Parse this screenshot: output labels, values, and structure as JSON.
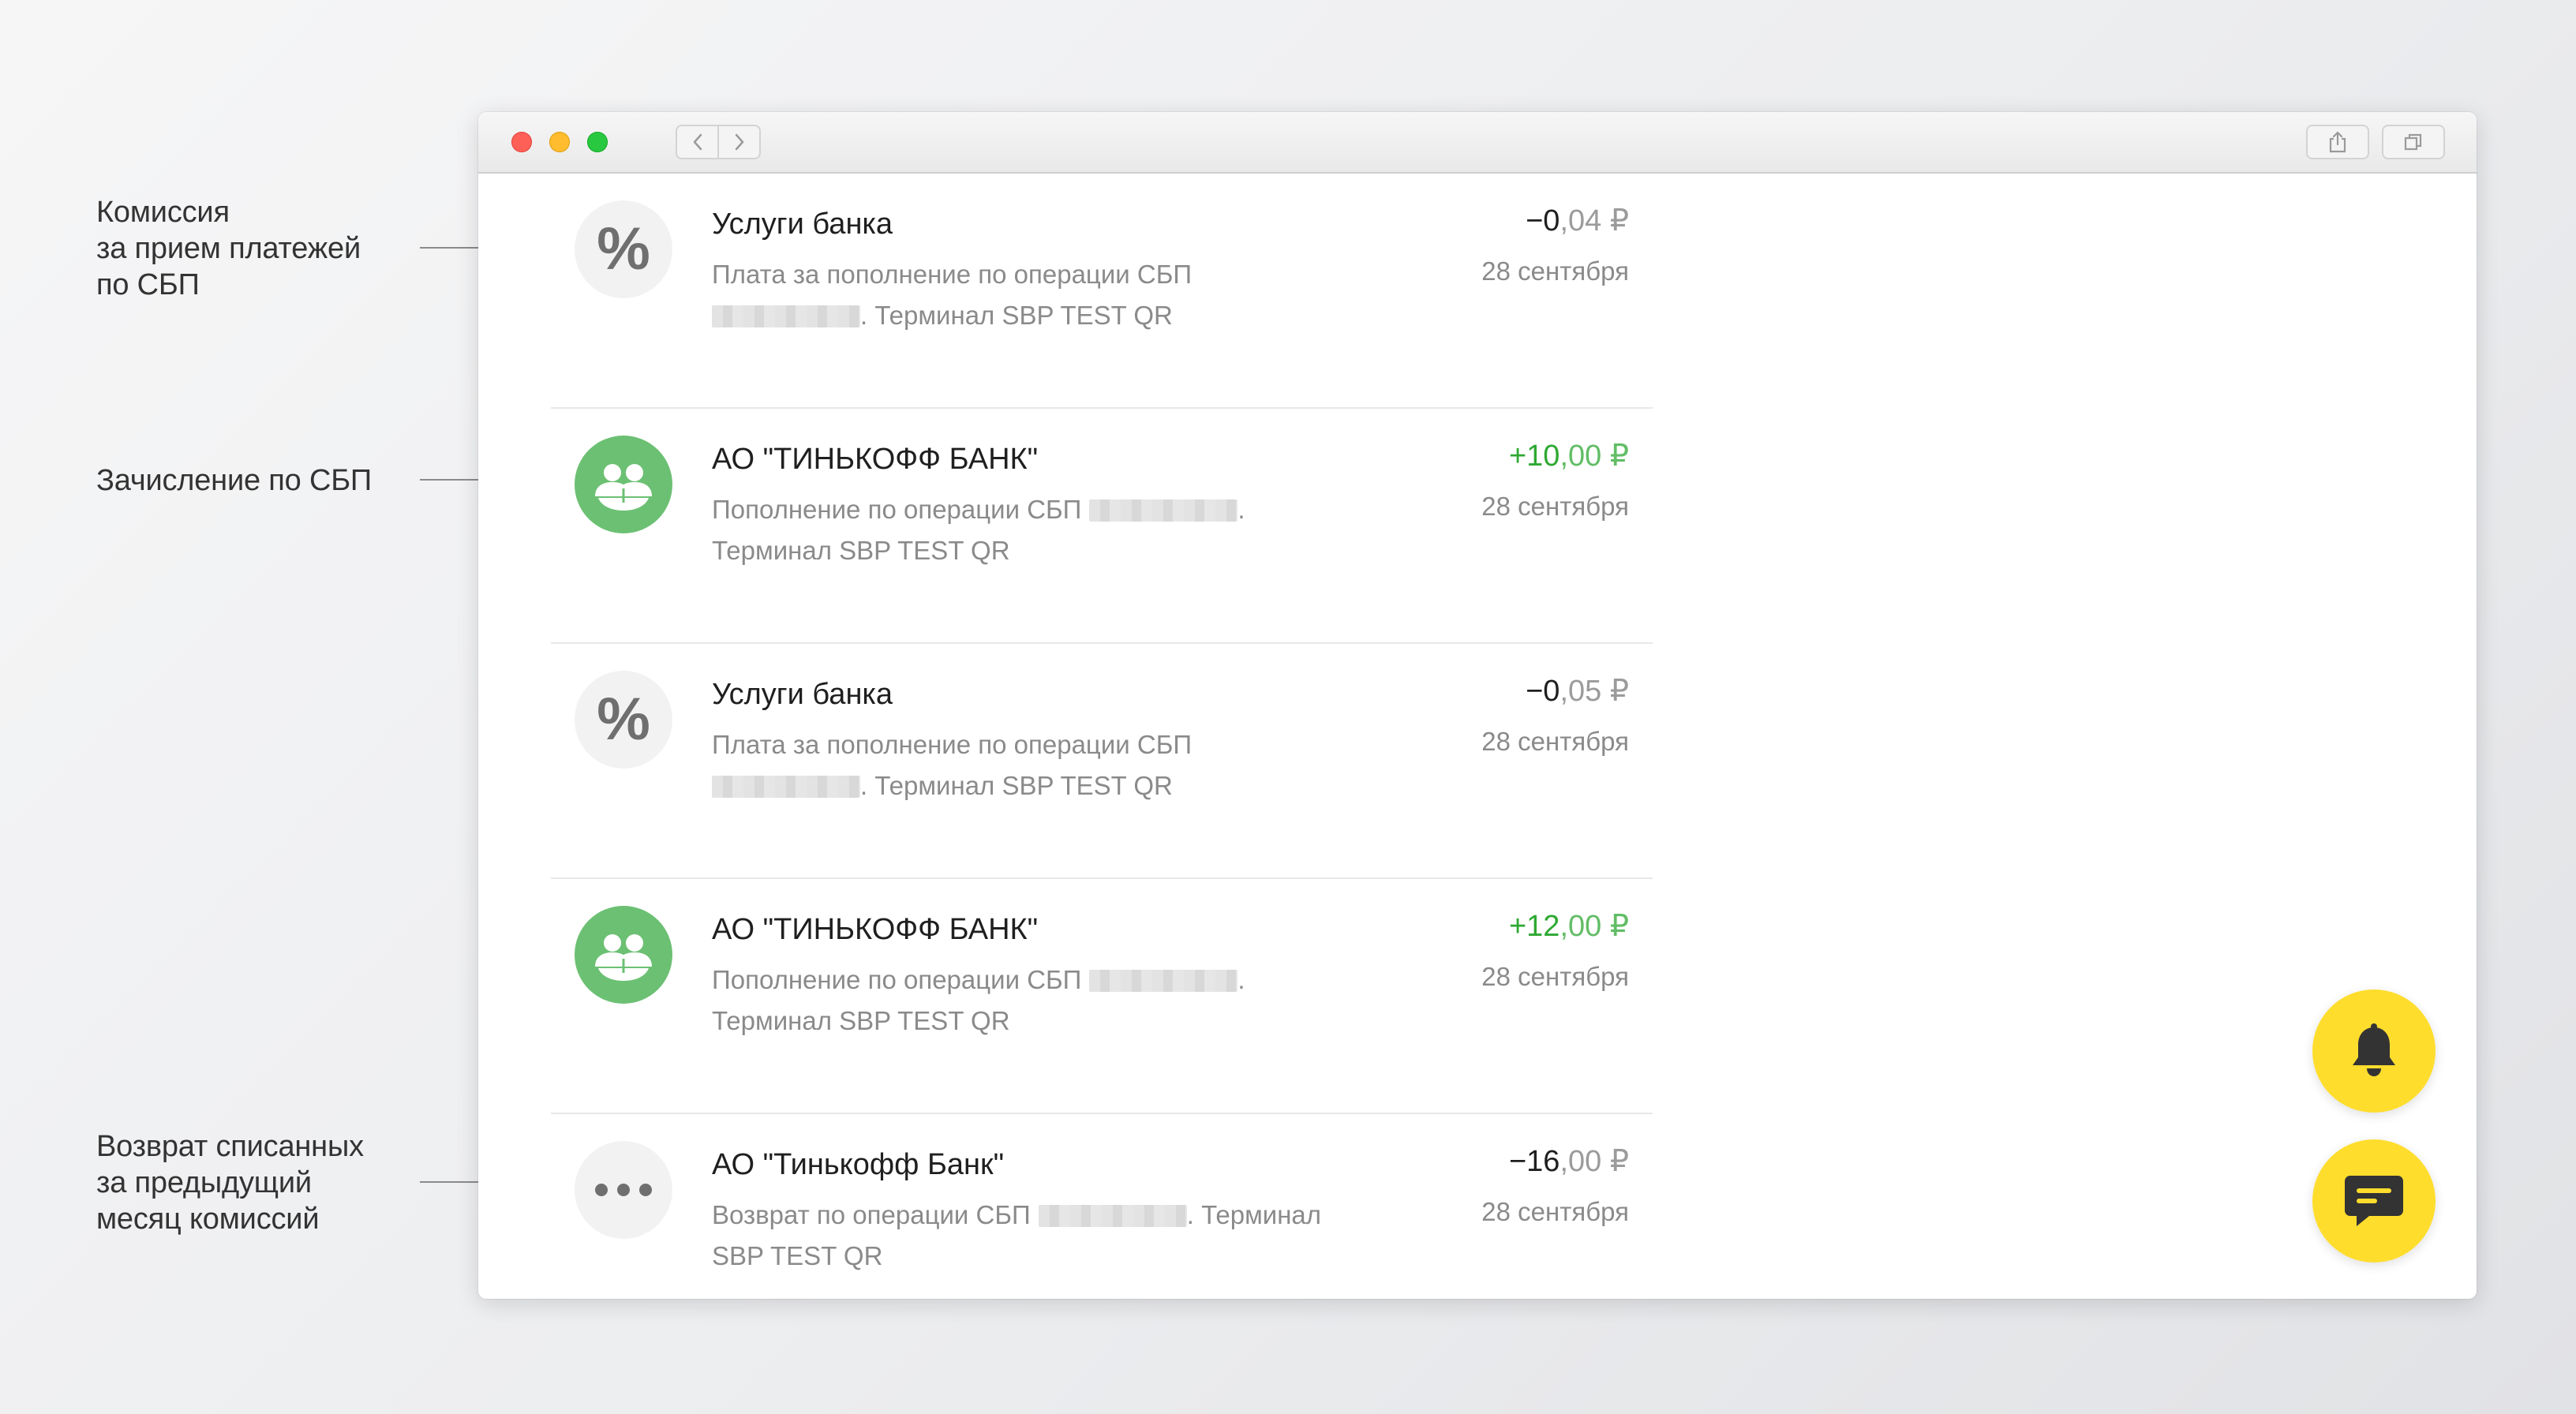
{
  "annotations": [
    {
      "lines": [
        "Комиссия",
        "за прием платежей",
        "по СБП"
      ]
    },
    {
      "lines": [
        "Зачисление по СБП"
      ]
    },
    {
      "lines": [
        "Возврат списанных",
        "за предыдущий",
        "месяц комиссий"
      ]
    }
  ],
  "window": {
    "traffic_lights": [
      "close",
      "minimize",
      "maximize"
    ],
    "icons": {
      "back": "chevron-left-icon",
      "forward": "chevron-right-icon",
      "share": "share-icon",
      "tabs": "tabs-icon"
    }
  },
  "transactions": [
    {
      "icon": "percent-icon",
      "icon_text": "%",
      "title": "Услуги банка",
      "desc_line1": "Плата за пополнение по операции СБП",
      "desc_line2": ". Терминал SBP TEST QR",
      "amount_int": "−0",
      "amount_frac": ",04 ₽",
      "date": "28 сентября"
    },
    {
      "icon": "people-icon",
      "title": "АО \"ТИНЬКОФФ БАНК\"",
      "desc_line1": "Пополнение по операции СБП",
      "desc_line1_tail": ".",
      "desc_line2": "Терминал SBP TEST QR",
      "amount_int": "+10",
      "amount_frac": ",00 ₽",
      "date": "28 сентября"
    },
    {
      "icon": "percent-icon",
      "icon_text": "%",
      "title": "Услуги банка",
      "desc_line1": "Плата за пополнение по операции СБП",
      "desc_line2": ". Терминал SBP TEST QR",
      "amount_int": "−0",
      "amount_frac": ",05 ₽",
      "date": "28 сентября"
    },
    {
      "icon": "people-icon",
      "title": "АО \"ТИНЬКОФФ БАНК\"",
      "desc_line1": "Пополнение по операции СБП",
      "desc_line1_tail": ".",
      "desc_line2": "Терминал SBP TEST QR",
      "amount_int": "+12",
      "amount_frac": ",00 ₽",
      "date": "28 сентября"
    },
    {
      "icon": "more-dots-icon",
      "title": "АО \"Тинькофф Банк\"",
      "desc_line1": "Возврат по операции СБП",
      "desc_line1_tail": ". Терминал",
      "desc_line2": "SBP TEST QR",
      "amount_int": "−16",
      "amount_frac": ",00 ₽",
      "date": "28 сентября"
    }
  ],
  "fabs": [
    {
      "icon": "bell-icon"
    },
    {
      "icon": "chat-icon"
    }
  ],
  "colors": {
    "income_green": "#2ea832",
    "icon_green": "#6cc073",
    "fab_yellow": "#ffdd2d",
    "traffic_close": "#fe5f57",
    "traffic_min": "#febc2e",
    "traffic_max": "#28c840"
  }
}
